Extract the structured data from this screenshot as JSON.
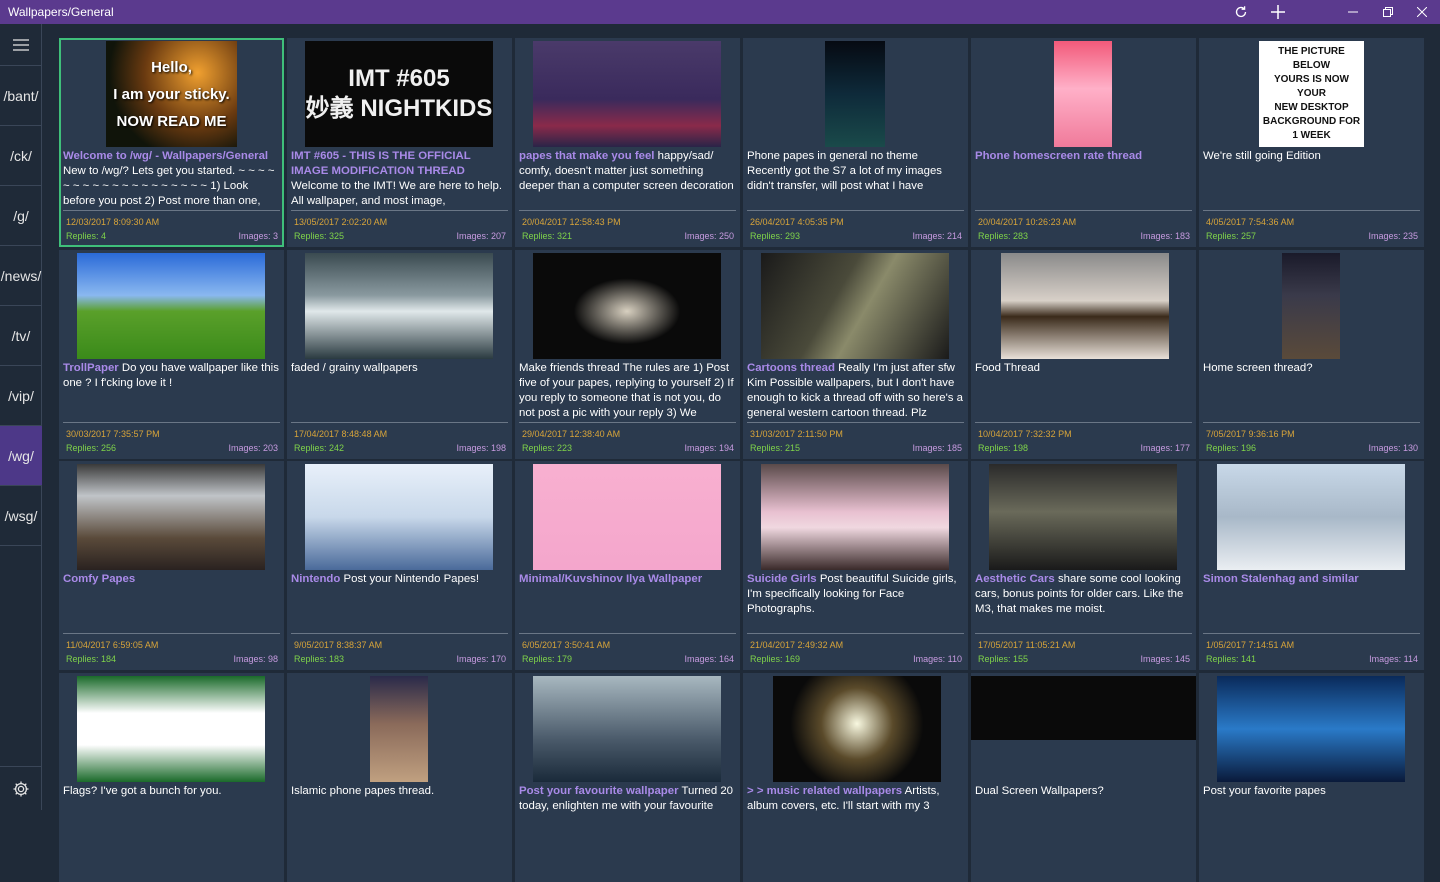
{
  "window": {
    "title": "Wallpapers/General",
    "refresh_icon": "refresh-icon",
    "add_icon": "plus-icon",
    "minimize_icon": "minimize-icon",
    "maximize_icon": "maximize-icon",
    "close_icon": "close-icon"
  },
  "sidebar": {
    "menu_icon": "hamburger-icon",
    "boards": [
      "/bant/",
      "/ck/",
      "/g/",
      "/news/",
      "/tv/",
      "/vip/",
      "/wg/",
      "/wsg/"
    ],
    "active_board": "/wg/",
    "settings_icon": "gear-icon"
  },
  "colors": {
    "titlebar": "#5b3a8e",
    "background": "#1f2a38",
    "card": "#2b3a4e",
    "subject": "#a98ae8",
    "date": "#d7a43a",
    "replies": "#7fd34a",
    "images": "#c79be0",
    "selected_border": "#3fbf7a"
  },
  "threads": [
    {
      "subject": "Welcome to /wg/ - Wallpapers/General",
      "body": "New to /wg/? Lets get you started. ~ ~ ~ ~ ~ ~ ~ ~ ~ ~ ~ ~ ~ ~ ~ ~ ~ ~ ~ 1) Look before you post 2) Post more than one,",
      "date": "12/03/2017 8:09:30 AM",
      "replies": "Replies: 4",
      "images": "Images: 3",
      "thumb_text": "Hello,\nI am your sticky.\nNOW READ ME"
    },
    {
      "subject": "IMT #605 - THIS IS THE OFFICIAL IMAGE MODIFICATION THREAD",
      "body": "Welcome to the IMT! We are here to help. All wallpaper, and most image, modification requests",
      "date": "13/05/2017 2:02:20 AM",
      "replies": "Replies: 325",
      "images": "Images: 207",
      "thumb_text": "IMT #605\n妙義 NIGHTKIDS"
    },
    {
      "subject": "papes that make you feel",
      "body": "happy/sad/ comfy, doesn't matter  just something deeper than a computer screen decoration",
      "date": "20/04/2017 12:58:43 PM",
      "replies": "Replies: 321",
      "images": "Images: 250",
      "thumb_text": ""
    },
    {
      "subject": "",
      "body": "Phone papes in general no theme Recently got the S7 a lot of my images didn't transfer, will post what I have",
      "date": "26/04/2017 4:05:35 PM",
      "replies": "Replies: 293",
      "images": "Images: 214",
      "thumb_text": ""
    },
    {
      "subject": "Phone homescreen rate thread",
      "body": "",
      "date": "20/04/2017 10:26:23 AM",
      "replies": "Replies: 283",
      "images": "Images: 183",
      "thumb_text": ""
    },
    {
      "subject": "",
      "body": "We're still going Edition",
      "date": "4/05/2017 7:54:36 AM",
      "replies": "Replies: 257",
      "images": "Images: 235",
      "thumb_text": "THE PICTURE BELOW\nYOURS IS NOW YOUR\nNEW DESKTOP\nBACKGROUND FOR\n1 WEEK"
    },
    {
      "subject": "TrollPaper",
      "body": "Do you have wallpaper like this one ? I f'cking love it !",
      "date": "30/03/2017 7:35:57 PM",
      "replies": "Replies: 256",
      "images": "Images: 203",
      "thumb_text": ""
    },
    {
      "subject": "",
      "body": "faded / grainy wallpapers",
      "date": "17/04/2017 8:48:48 AM",
      "replies": "Replies: 242",
      "images": "Images: 198",
      "thumb_text": ""
    },
    {
      "subject": "",
      "body": "Make friends thread The rules are   1) Post five of your papes, replying to yourself  2) If you reply to someone that is not you, do not post a pic with your reply  3) We",
      "date": "29/04/2017 12:38:40 AM",
      "replies": "Replies: 223",
      "images": "Images: 194",
      "thumb_text": ""
    },
    {
      "subject": "Cartoons thread",
      "body": "Really I'm just after sfw Kim Possible wallpapers, but I don't have enough to kick a thread off with so here's a general western cartoon thread.  Plz",
      "date": "31/03/2017 2:11:50 PM",
      "replies": "Replies: 215",
      "images": "Images: 185",
      "thumb_text": ""
    },
    {
      "subject": "",
      "body": "Food Thread",
      "date": "10/04/2017 7:32:32 PM",
      "replies": "Replies: 198",
      "images": "Images: 177",
      "thumb_text": ""
    },
    {
      "subject": "",
      "body": "Home screen thread?",
      "date": "7/05/2017 9:36:16 PM",
      "replies": "Replies: 196",
      "images": "Images: 130",
      "thumb_text": ""
    },
    {
      "subject": "Comfy Papes",
      "body": "",
      "date": "11/04/2017 6:59:05 AM",
      "replies": "Replies: 184",
      "images": "Images: 98",
      "thumb_text": ""
    },
    {
      "subject": "Nintendo",
      "body": "Post your Nintendo Papes!",
      "date": "9/05/2017 8:38:37 AM",
      "replies": "Replies: 183",
      "images": "Images: 170",
      "thumb_text": ""
    },
    {
      "subject": "Minimal/Kuvshinov Ilya Wallpaper",
      "body": "",
      "date": "6/05/2017 3:50:41 AM",
      "replies": "Replies: 179",
      "images": "Images: 164",
      "thumb_text": ""
    },
    {
      "subject": "Suicide Girls",
      "body": "Post beautiful Suicide girls, I'm specifically looking for Face Photographs.",
      "date": "21/04/2017 2:49:32 AM",
      "replies": "Replies: 169",
      "images": "Images: 110",
      "thumb_text": ""
    },
    {
      "subject": "Aesthetic Cars",
      "body": "share some cool looking cars, bonus points for older cars. Like the M3, that makes me moist.",
      "date": "17/05/2017 11:05:21 AM",
      "replies": "Replies: 155",
      "images": "Images: 145",
      "thumb_text": ""
    },
    {
      "subject": "Simon Stalenhag and similar",
      "body": "",
      "date": "1/05/2017 7:14:51 AM",
      "replies": "Replies: 141",
      "images": "Images: 114",
      "thumb_text": ""
    },
    {
      "subject": "",
      "body": "Flags? I've got a bunch for you.",
      "date": "",
      "replies": "",
      "images": "",
      "thumb_text": ""
    },
    {
      "subject": "",
      "body": "Islamic phone papes thread.",
      "date": "",
      "replies": "",
      "images": "",
      "thumb_text": ""
    },
    {
      "subject": "Post your favourite wallpaper",
      "body": "Turned 20 today, enlighten me with your favourite",
      "date": "",
      "replies": "",
      "images": "",
      "thumb_text": ""
    },
    {
      "subject": "> > music related wallpapers",
      "body": "Artists, album covers, etc.  I'll start with my 3",
      "date": "",
      "replies": "",
      "images": "",
      "thumb_text": ""
    },
    {
      "subject": "",
      "body": "Dual Screen Wallpapers?",
      "date": "",
      "replies": "",
      "images": "",
      "thumb_text": ""
    },
    {
      "subject": "",
      "body": "Post your favorite papes",
      "date": "",
      "replies": "",
      "images": "",
      "thumb_text": ""
    }
  ]
}
